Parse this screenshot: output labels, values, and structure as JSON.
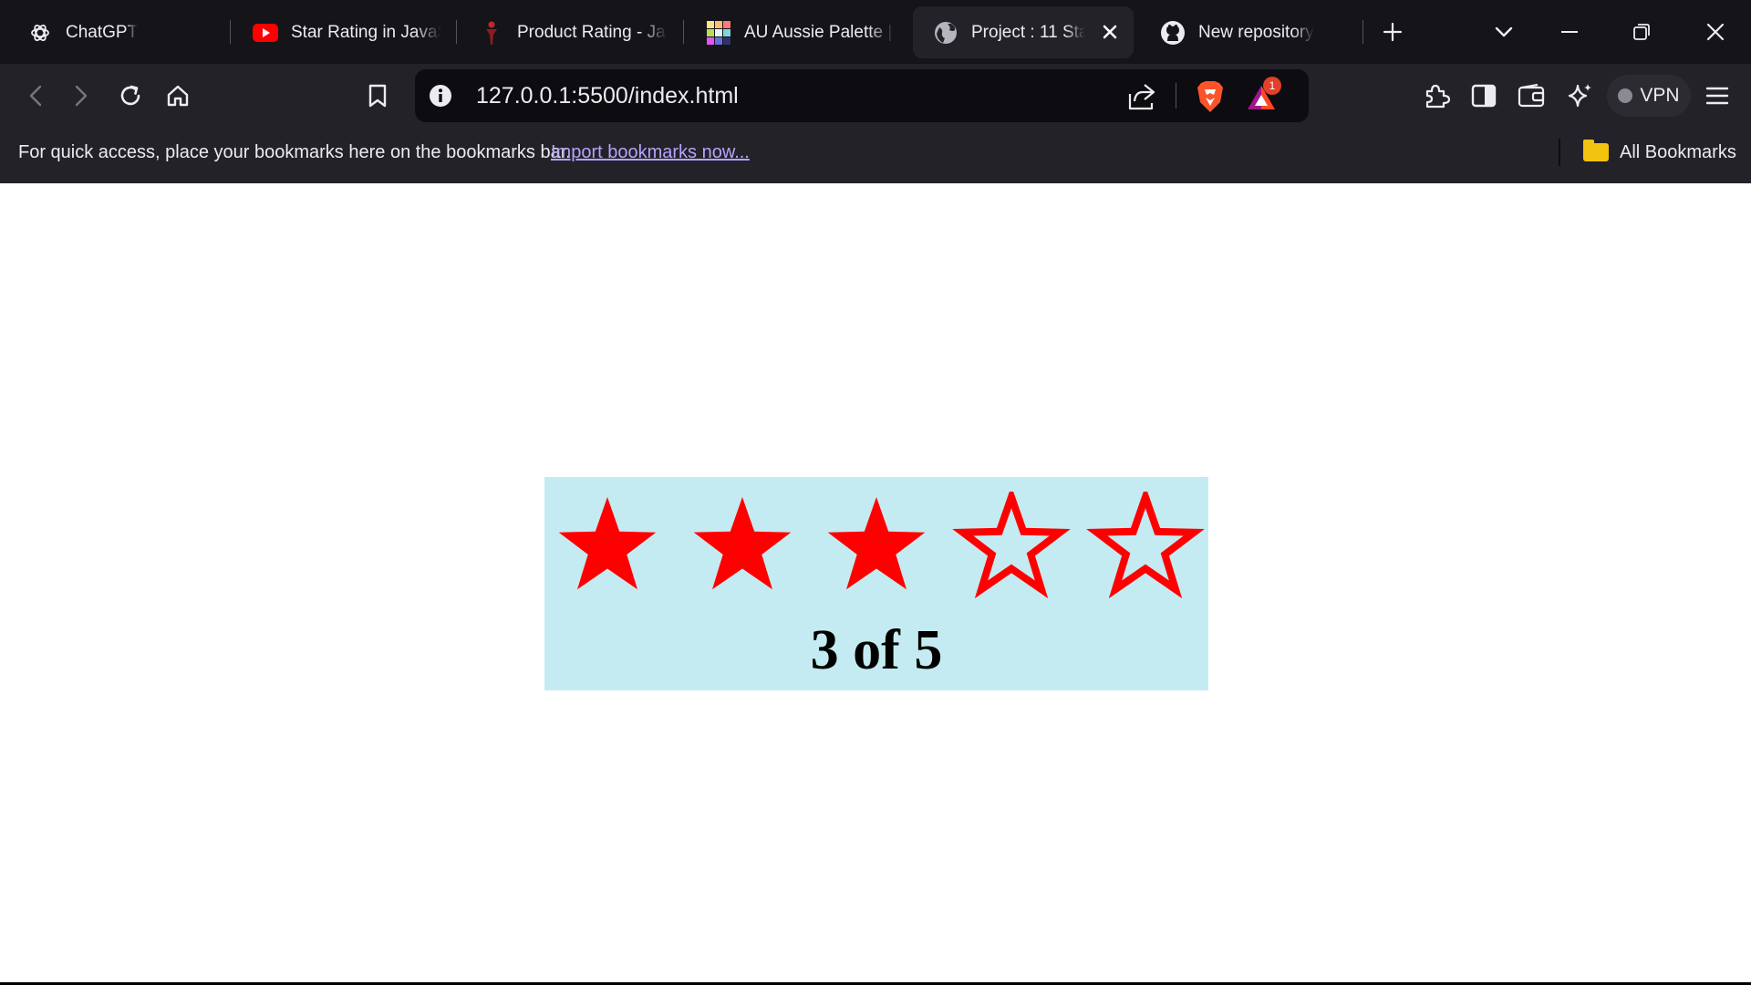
{
  "browser": {
    "tabs": [
      {
        "title": "ChatGPT",
        "favicon": "chatgpt-icon",
        "active": false
      },
      {
        "title": "Star Rating in JavaScript",
        "favicon": "youtube-icon",
        "active": false
      },
      {
        "title": "Product Rating - Ja",
        "favicon": "product-rating-icon",
        "active": false
      },
      {
        "title": "AU Aussie Palette | F",
        "favicon": "palette-icon",
        "active": false
      },
      {
        "title": "Project : 11 Sta",
        "favicon": "globe-icon",
        "active": true
      },
      {
        "title": "New repository",
        "favicon": "github-icon",
        "active": false
      }
    ],
    "url": "127.0.0.1:5500/index.html",
    "rewards_badge": "1",
    "vpn_label": "VPN",
    "bookmarks_bar": {
      "message": "For quick access, place your bookmarks here on the bookmarks bar.",
      "import_link": "Import bookmarks now...",
      "all_bookmarks": "All Bookmarks"
    }
  },
  "rating": {
    "value": 3,
    "max": 5,
    "label": "3 of 5",
    "star_color": "#ff0000",
    "box_color": "#c5ebf2"
  }
}
